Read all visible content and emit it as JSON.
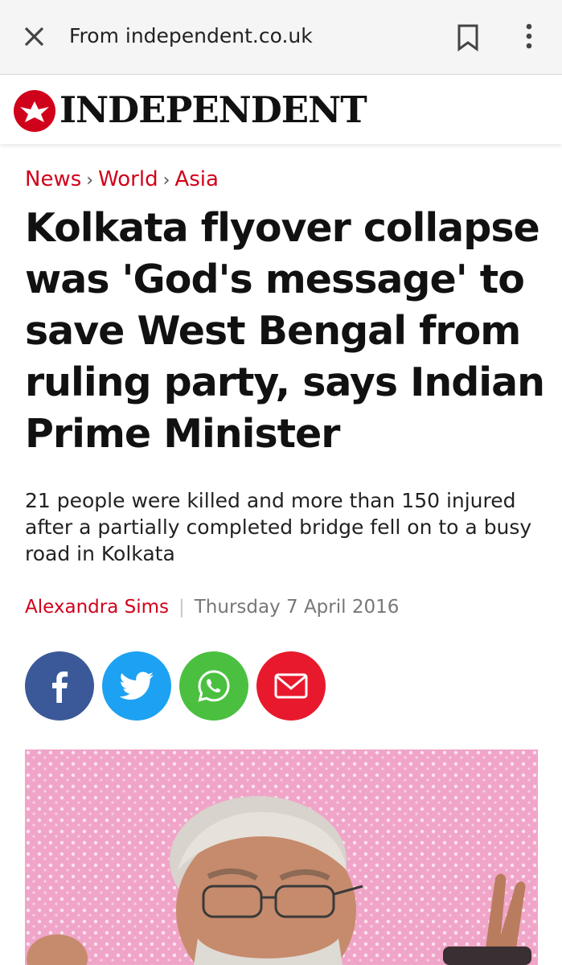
{
  "browser": {
    "source_label": "From independent.co.uk",
    "icons": {
      "close": "close-icon",
      "bookmark": "bookmark-icon",
      "menu": "more-vert-icon"
    }
  },
  "site": {
    "name": "INDEPENDENT",
    "logo_icon": "eagle-logo-icon",
    "brand_color": "#d0021b"
  },
  "breadcrumb": [
    "News",
    "World",
    "Asia"
  ],
  "article": {
    "headline": "Kolkata flyover collapse was 'God's message' to save West Bengal from ruling party, says Indian Prime Minister",
    "standfirst": "21 people were killed and more than 150 injured after a partially completed bridge fell on to a busy road in Kolkata",
    "author": "Alexandra Sims",
    "date": "Thursday 7 April 2016"
  },
  "share": [
    {
      "network": "facebook",
      "icon": "facebook-icon",
      "color": "#3b5998"
    },
    {
      "network": "twitter",
      "icon": "twitter-icon",
      "color": "#1da1f2"
    },
    {
      "network": "whatsapp",
      "icon": "whatsapp-icon",
      "color": "#4bc040"
    },
    {
      "network": "email",
      "icon": "email-icon",
      "color": "#e8192c"
    }
  ]
}
